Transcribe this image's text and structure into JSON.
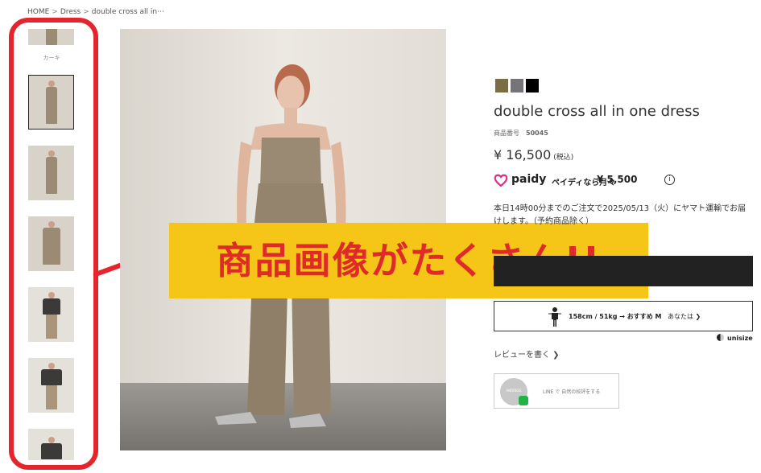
{
  "breadcrumb": {
    "home": "HOME",
    "category": "Dress",
    "current": "double cross all in⋯",
    "separator": ">"
  },
  "thumbnails": {
    "color_label": "カーキ",
    "count": 7
  },
  "callout": {
    "text": "商品画像がたくさん!!",
    "background": "#f5c518",
    "text_color": "#e02a2a",
    "frame_color": "#e5252d"
  },
  "product": {
    "swatches": [
      "#7a6e47",
      "#77737a",
      "#000000"
    ],
    "title": "double cross all in one dress",
    "sku_label": "商品番号",
    "sku_value": "50045",
    "price": "¥ 16,500",
    "tax_note": "(税込)"
  },
  "paidy": {
    "brand": "paidy",
    "note": "ペイディなら月々",
    "amount": "¥ 5,500",
    "info_icon": "ⓘ",
    "brand_color": "#d8318c"
  },
  "delivery_notice": "本日14時00分までのご注文で2025/05/13（火）にヤマト運輸でお届けします。（予約商品除く）",
  "unisize": {
    "recommendation": "158cm / 51kg → おすすめ M",
    "you_label": "あなたは ❯",
    "brand": "unisize"
  },
  "review_link": "レビューを書く ❯",
  "line_widget": {
    "avatar_text": "ANDRESS",
    "text": "LINE で 自然の校評をする"
  }
}
